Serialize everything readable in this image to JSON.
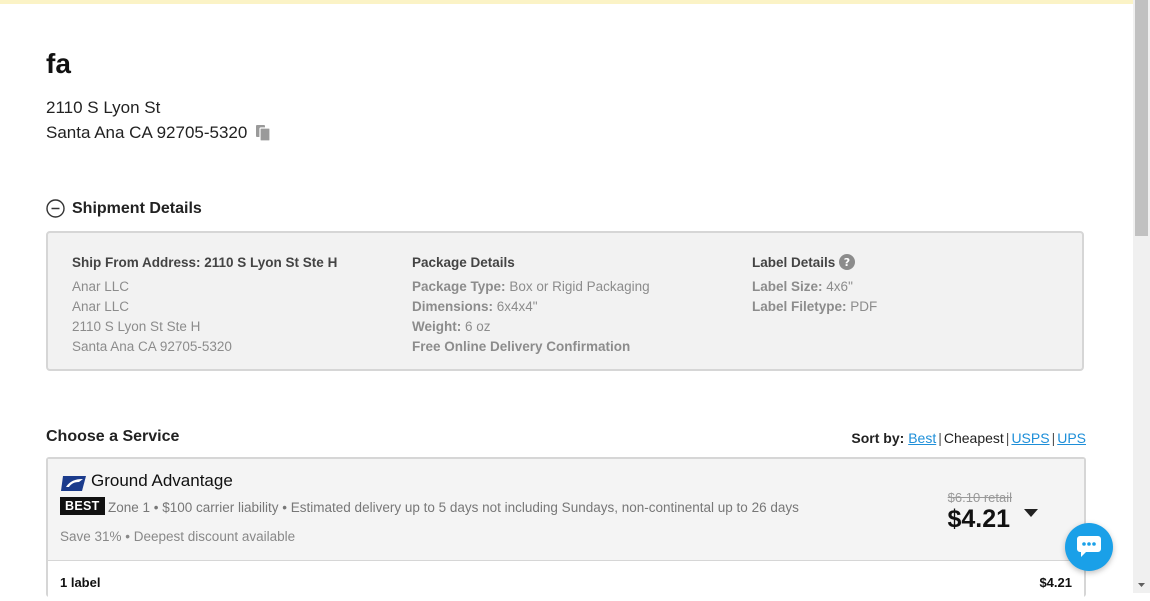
{
  "recipient": {
    "name": "fa",
    "address_line1": "2110 S Lyon St",
    "address_line2": "Santa Ana CA 92705-5320"
  },
  "shipment_details": {
    "title": "Shipment Details",
    "ship_from": {
      "heading": "Ship From Address: 2110 S Lyon St Ste H",
      "lines": [
        "Anar LLC",
        "Anar LLC",
        "2110 S Lyon St Ste H",
        "Santa Ana CA 92705-5320"
      ]
    },
    "package": {
      "heading": "Package Details",
      "type_label": "Package Type:",
      "type_value": "Box or Rigid Packaging",
      "dimensions_label": "Dimensions:",
      "dimensions_value": "6x4x4\"",
      "weight_label": "Weight:",
      "weight_value": "6 oz",
      "confirmation": "Free Online Delivery Confirmation"
    },
    "label": {
      "heading": "Label Details",
      "size_label": "Label Size:",
      "size_value": "4x6\"",
      "filetype_label": "Label Filetype:",
      "filetype_value": "PDF"
    }
  },
  "choose_service": {
    "title": "Choose a Service",
    "sort_label": "Sort by:",
    "sort_options": [
      "Best",
      "Cheapest",
      "USPS",
      "UPS"
    ],
    "selected_sort": "Cheapest"
  },
  "service": {
    "name": "Ground Advantage",
    "badge": "BEST",
    "description": "Zone 1 • $100 carrier liability • Estimated delivery up to 5 days not including Sundays, non-continental up to 26 days",
    "savings": "Save 31% • Deepest discount available",
    "retail": "$6.10 retail",
    "price": "$4.21",
    "footer_left": "1 label",
    "footer_right": "$4.21"
  },
  "colors": {
    "link": "#1e8fd9",
    "chat_button": "#1aa0e8",
    "usps_blue": "#1b3b8c",
    "top_strip": "#fbf3c6"
  },
  "icons": {
    "copy": "copy-icon",
    "collapse": "minus-circle-icon",
    "help": "question-icon",
    "carrier": "usps-eagle-icon",
    "expand": "caret-down-icon",
    "chat": "chat-bubble-icon"
  }
}
